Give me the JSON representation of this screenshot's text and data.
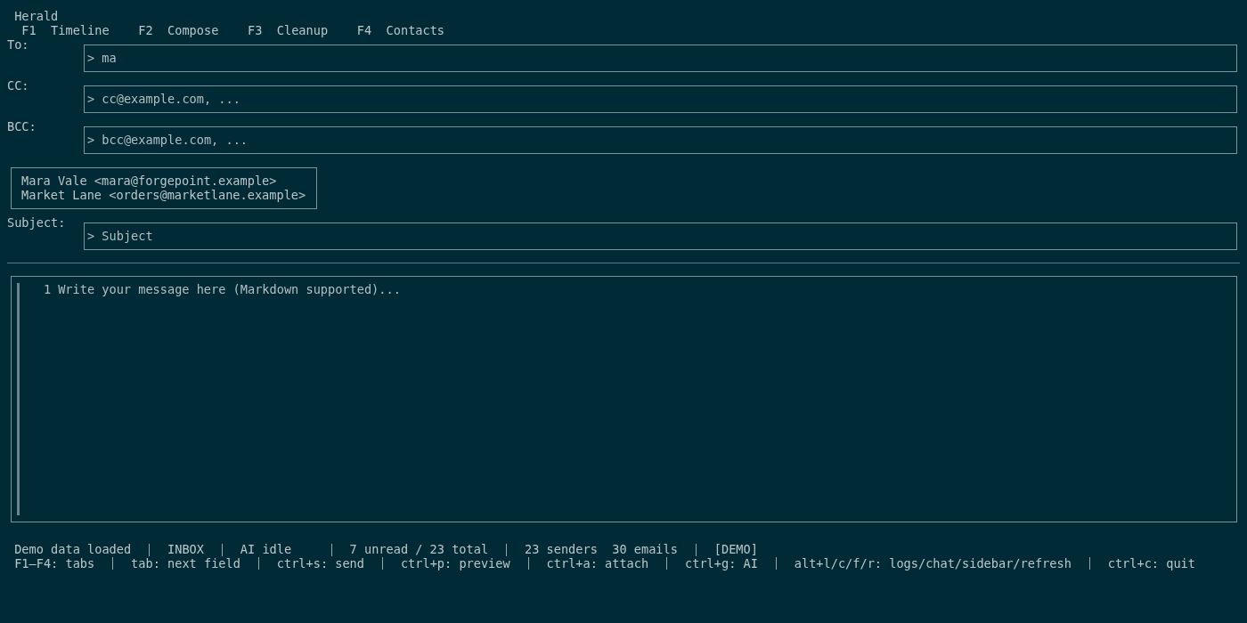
{
  "header": {
    "title": "Herald",
    "tabs": [
      {
        "key": "F1",
        "label": "Timeline"
      },
      {
        "key": "F2",
        "label": "Compose"
      },
      {
        "key": "F3",
        "label": "Cleanup"
      },
      {
        "key": "F4",
        "label": "Contacts"
      }
    ]
  },
  "compose": {
    "fields": [
      {
        "label": "To:",
        "prompt": ">",
        "value": "ma"
      },
      {
        "label": "CC:",
        "prompt": ">",
        "placeholder": "cc@example.com, ..."
      },
      {
        "label": "BCC:",
        "prompt": ">",
        "placeholder": "bcc@example.com, ..."
      }
    ],
    "suggestions": [
      "Mara Vale <mara@forgepoint.example>",
      "Market Lane <orders@marketlane.example>"
    ],
    "subject": {
      "label": "Subject:",
      "prompt": ">",
      "placeholder": "Subject"
    }
  },
  "editor": {
    "line_number": "1",
    "placeholder": "Write your message here (Markdown supported)..."
  },
  "status_bar": {
    "items": [
      "Demo data loaded",
      "INBOX",
      "AI idle",
      "7 unread / 23 total",
      "23 senders  30 emails",
      "[DEMO]"
    ],
    "shortcuts": [
      "F1–F4: tabs",
      "tab: next field",
      "ctrl+s: send",
      "ctrl+p: preview",
      "ctrl+a: attach",
      "ctrl+g: AI",
      "alt+l/c/f/r: logs/chat/sidebar/refresh",
      "ctrl+c: quit"
    ]
  }
}
